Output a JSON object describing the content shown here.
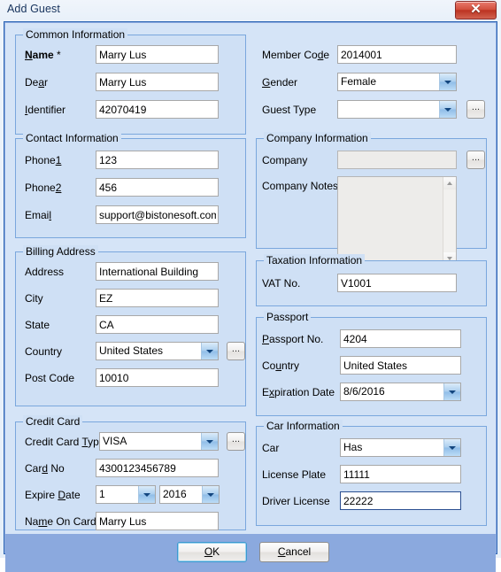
{
  "window": {
    "title": "Add Guest",
    "close_icon": "close-icon",
    "close_glyph": "✕"
  },
  "groups": {
    "common": {
      "legend": "Common Information",
      "fields": {
        "name": {
          "label": "Name",
          "accel": "N",
          "required_mark": "*",
          "value": "Marry Lus"
        },
        "dear": {
          "label": "Dear",
          "accel": "a",
          "value": "Marry Lus"
        },
        "identifier": {
          "label": "Identifier",
          "accel": "I",
          "value": "42070419"
        },
        "member_code": {
          "label": "Member Code",
          "accel": "d",
          "value": "2014001"
        },
        "gender": {
          "label": "Gender",
          "accel": "G",
          "value": "Female"
        },
        "guest_type": {
          "label": "Guest Type",
          "value": ""
        }
      }
    },
    "contact": {
      "legend": "Contact Information",
      "fields": {
        "phone1": {
          "label": "Phone1",
          "accel": "1",
          "value": "123"
        },
        "phone2": {
          "label": "Phone2",
          "accel": "2",
          "value": "456"
        },
        "email": {
          "label": "Email",
          "accel": "l",
          "value": "support@bistonesoft.com"
        }
      }
    },
    "company": {
      "legend": "Company Information",
      "fields": {
        "company": {
          "label": "Company",
          "value": ""
        },
        "company_notes": {
          "label": "Company Notes",
          "value": ""
        }
      }
    },
    "billing": {
      "legend": "Billing Address",
      "fields": {
        "address": {
          "label": "Address",
          "value": "International Building"
        },
        "city": {
          "label": "City",
          "value": "EZ"
        },
        "state": {
          "label": "State",
          "value": "CA"
        },
        "country": {
          "label": "Country",
          "value": "United States"
        },
        "post_code": {
          "label": "Post Code",
          "value": "10010"
        }
      }
    },
    "taxation": {
      "legend": "Taxation Information",
      "fields": {
        "vat_no": {
          "label": "VAT No.",
          "value": "V1001"
        }
      }
    },
    "passport": {
      "legend": "Passport",
      "fields": {
        "passport_no": {
          "label": "Passport No.",
          "accel": "P",
          "value": "4204"
        },
        "country": {
          "label": "Country",
          "accel": "u",
          "value": "United States"
        },
        "expiration_date": {
          "label": "Expiration Date",
          "accel": "x",
          "value": "8/6/2016"
        }
      }
    },
    "credit_card": {
      "legend": "Credit Card",
      "fields": {
        "card_type": {
          "label": "Credit Card Type",
          "accel": "T",
          "value": "VISA"
        },
        "card_no": {
          "label": "Card No",
          "accel": "d",
          "value": "4300123456789"
        },
        "expire_date": {
          "label": "Expire Date",
          "accel": "D",
          "month": "1",
          "year": "2016"
        },
        "name_on_card": {
          "label": "Name On Card",
          "accel": "m",
          "value": "Marry Lus"
        }
      }
    },
    "car": {
      "legend": "Car Information",
      "fields": {
        "car": {
          "label": "Car",
          "value": "Has"
        },
        "license_plate": {
          "label": "License Plate",
          "value": "11111"
        },
        "driver_license": {
          "label": "Driver License",
          "value": "22222"
        }
      }
    }
  },
  "buttons": {
    "ok": {
      "label": "OK",
      "accel": "O"
    },
    "cancel": {
      "label": "Cancel",
      "accel": "C"
    },
    "ellipsis": "..."
  },
  "colors": {
    "panel_bg": "#d5e4f7",
    "group_bg": "#cfe0f5",
    "group_border": "#7aa7dd",
    "footer_bg": "#8ba9de",
    "focus_border": "#2b4f91",
    "close_red": "#bc3322"
  }
}
